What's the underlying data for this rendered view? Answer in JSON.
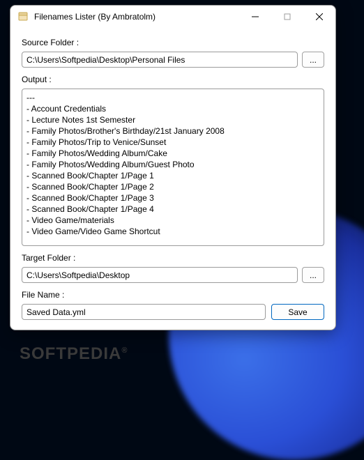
{
  "window": {
    "title": "Filenames Lister (By Ambratolm)"
  },
  "labels": {
    "source_folder": "Source Folder :",
    "output": "Output :",
    "target_folder": "Target Folder :",
    "file_name": "File Name :"
  },
  "fields": {
    "source_folder_value": "C:\\Users\\Softpedia\\Desktop\\Personal Files",
    "target_folder_value": "C:\\Users\\Softpedia\\Desktop",
    "file_name_value": "Saved Data.yml"
  },
  "buttons": {
    "browse": "...",
    "save": "Save"
  },
  "output_lines": [
    "---",
    "- Account Credentials",
    "- Lecture Notes 1st Semester",
    "- Family Photos/Brother's Birthday/21st January 2008",
    "- Family Photos/Trip to Venice/Sunset",
    "- Family Photos/Wedding Album/Cake",
    "- Family Photos/Wedding Album/Guest Photo",
    "- Scanned Book/Chapter 1/Page 1",
    "- Scanned Book/Chapter 1/Page 2",
    "- Scanned Book/Chapter 1/Page 3",
    "- Scanned Book/Chapter 1/Page 4",
    "- Video Game/materials",
    "- Video Game/Video Game Shortcut"
  ],
  "watermark": "SOFTPEDIA",
  "watermark_suffix": "®"
}
